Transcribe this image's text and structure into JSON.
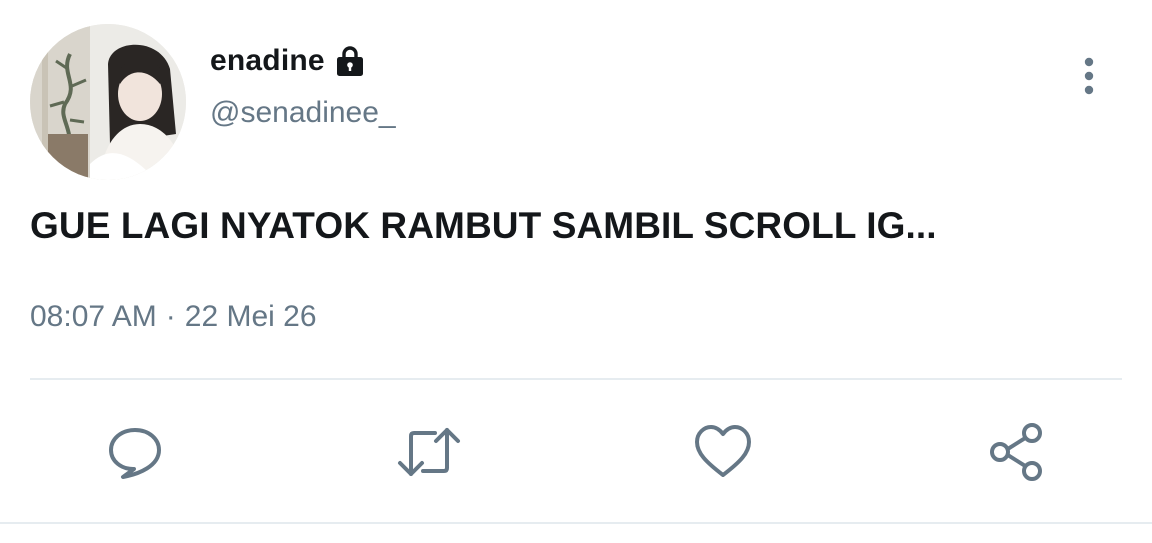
{
  "user": {
    "display_name": "enadine",
    "handle": "@senadinee_",
    "protected": true,
    "avatar_icon": "profile-photo"
  },
  "tweet": {
    "text": "GUE LAGI NYATOK RAMBUT SAMBIL SCROLL IG...",
    "time": "08:07 AM",
    "separator": "·",
    "date": "22 Mei 26"
  },
  "actions": {
    "reply_icon": "comment-icon",
    "retweet_icon": "retweet-icon",
    "like_icon": "heart-icon",
    "share_icon": "share-icon"
  },
  "colors": {
    "text_primary": "#14171a",
    "text_secondary": "#657786",
    "icon": "#657786",
    "divider": "#e6ecf0"
  }
}
